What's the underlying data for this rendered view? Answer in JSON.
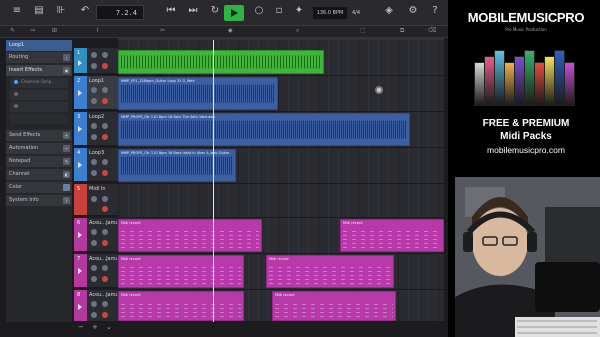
{
  "toolbar": {
    "position": "7.2.4",
    "bpm": "136.0 BPM",
    "signature": "4/4",
    "icons": [
      "menu-icon",
      "browser-icon",
      "mixer-icon",
      "rewind-icon",
      "forward-icon",
      "loop-icon",
      "play-icon",
      "record-icon",
      "metronome-icon",
      "wand-icon",
      "settings-icon",
      "help-icon"
    ]
  },
  "ruler": {
    "marks": [
      "",
      "",
      "",
      "",
      "",
      "",
      "",
      ""
    ]
  },
  "inspector": {
    "track_name": "Loop1",
    "items": [
      "Routing",
      "Insert Effects",
      "Send Effects",
      "Automation",
      "Notepad",
      "Channel",
      "Color",
      "System Info"
    ],
    "sub_items": [
      "Channel Strip",
      "",
      ""
    ]
  },
  "tracks": [
    {
      "num": "1",
      "name": "",
      "color": "#2f8ec4"
    },
    {
      "num": "2",
      "name": "Loop1",
      "color": "#3a7fd0"
    },
    {
      "num": "3",
      "name": "Loop2",
      "color": "#3a7fd0"
    },
    {
      "num": "4",
      "name": "Loop3",
      "color": "#3a7fd0"
    },
    {
      "num": "5",
      "name": "Midi In",
      "color": "#c8423a"
    },
    {
      "num": "6",
      "name": "Acou...Jamz",
      "color": "#b5389f"
    },
    {
      "num": "7",
      "name": "Acou...Jamz",
      "color": "#b5389f"
    },
    {
      "num": "8",
      "name": "Acou...Jamz",
      "color": "#b5389f"
    }
  ],
  "clips": {
    "loop1": "MMP_EP1_128bpm_Guitar Loop 25 G_Wed",
    "loop2": "MMP_PROPS_Gtr 110 Bpm 16 Bars The Sails Wed.wav",
    "loop3": "MMP_PROPS_Gtr 110 Bpm 16 Bars Heist in Uber A_wav Guitar",
    "midi": "Midi record"
  },
  "ad": {
    "logo": "MOBILEMUSICPRO",
    "tagline": "Pro Music Production",
    "line1": "FREE & PREMIUM",
    "line2": "Midi Packs",
    "url": "mobilemusicpro.com",
    "box_colors": [
      "#d8d8d8",
      "#e85b8f",
      "#5cc1e6",
      "#f0b34a",
      "#7b4fd0",
      "#36b36a",
      "#e84a3a",
      "#f7e25a",
      "#2f5fc0",
      "#c94fd6"
    ]
  },
  "colors": {
    "green_clip": "#3fb63a",
    "blue_clip": "#3c5ea3",
    "pink_clip": "#b83aaa",
    "play": "#2fb344"
  }
}
